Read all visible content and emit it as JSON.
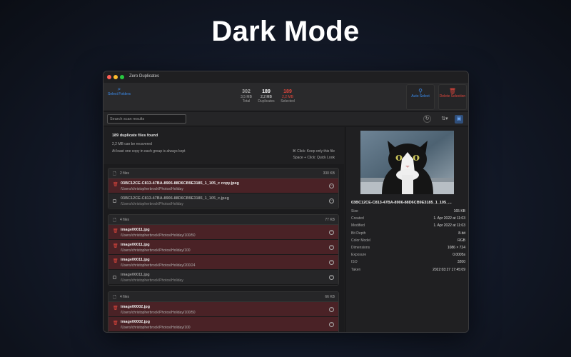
{
  "headline": "Dark Mode",
  "window": {
    "title": "Zero Duplicates"
  },
  "toolbar": {
    "select_folders": "Select Folders",
    "auto_select": "Auto Select",
    "delete_selection": "Delete Selection",
    "stats": {
      "total": {
        "count": "302",
        "size": "3,5 MB",
        "label": "Total"
      },
      "duplicates": {
        "count": "189",
        "size": "2,2 MB",
        "label": "Duplicates"
      },
      "selected": {
        "count": "189",
        "size": "2,2 MB",
        "label": "Selected"
      }
    }
  },
  "search": {
    "placeholder": "Search scan results"
  },
  "summary": {
    "found": "189 duplicate files found",
    "recoverable": "2,2 MB can be recovered",
    "kept_note": "At least one copy in each group is always kept",
    "hint_keep": "⌘ Click: Keep only this file",
    "hint_quicklook": "Space + Click: Quick Look"
  },
  "groups": [
    {
      "count": "2 files",
      "size": "330 KB",
      "rows": [
        {
          "name": "03BC12CE-C813-47BA-8906-88D6CB9E3185_1_105_c copy.jpeg",
          "path": "/Users/christopherbrock/Photos/Holiday"
        },
        {
          "name": "03BC12CE-C813-47BA-8906-88D6CB9E3185_1_105_c.jpeg",
          "path": "/Users/christopherbrock/Photos/Holiday"
        }
      ]
    },
    {
      "count": "4 files",
      "size": "77 KB",
      "rows": [
        {
          "name": "image00011.jpg",
          "path": "/Users/christopherbrock/Photos/Holiday/100/50"
        },
        {
          "name": "image00011.jpg",
          "path": "/Users/christopherbrock/Photos/Holiday/100"
        },
        {
          "name": "image00011.jpg",
          "path": "/Users/christopherbrock/Photos/Holiday/200/24"
        },
        {
          "name": "image00011.jpg",
          "path": "/Users/christopherbrock/Photos/Holiday"
        }
      ]
    },
    {
      "count": "4 files",
      "size": "66 KB",
      "rows": [
        {
          "name": "image00002.jpg",
          "path": "/Users/christopherbrock/Photos/Holiday/100/50"
        },
        {
          "name": "image00002.jpg",
          "path": "/Users/christopherbrock/Photos/Holiday/100"
        }
      ]
    }
  ],
  "preview": {
    "filename": "03BC12CE-C813-47BA-8906-88D6CB9E3185_1_105_...",
    "props": [
      {
        "k": "Size",
        "v": "165 KB"
      },
      {
        "k": "Created",
        "v": "1. Apr 2022 at 11:03"
      },
      {
        "k": "Modified",
        "v": "1. Apr 2022 at 11:03"
      },
      {
        "k": "Bit Depth",
        "v": "8-bit"
      },
      {
        "k": "Color Model",
        "v": "RGB"
      },
      {
        "k": "Dimensions",
        "v": "1086 × 724"
      },
      {
        "k": "Exposure",
        "v": "0.0005s"
      },
      {
        "k": "ISO",
        "v": "3200"
      },
      {
        "k": "Taken",
        "v": "2022:03:27 17:45:09"
      }
    ]
  }
}
